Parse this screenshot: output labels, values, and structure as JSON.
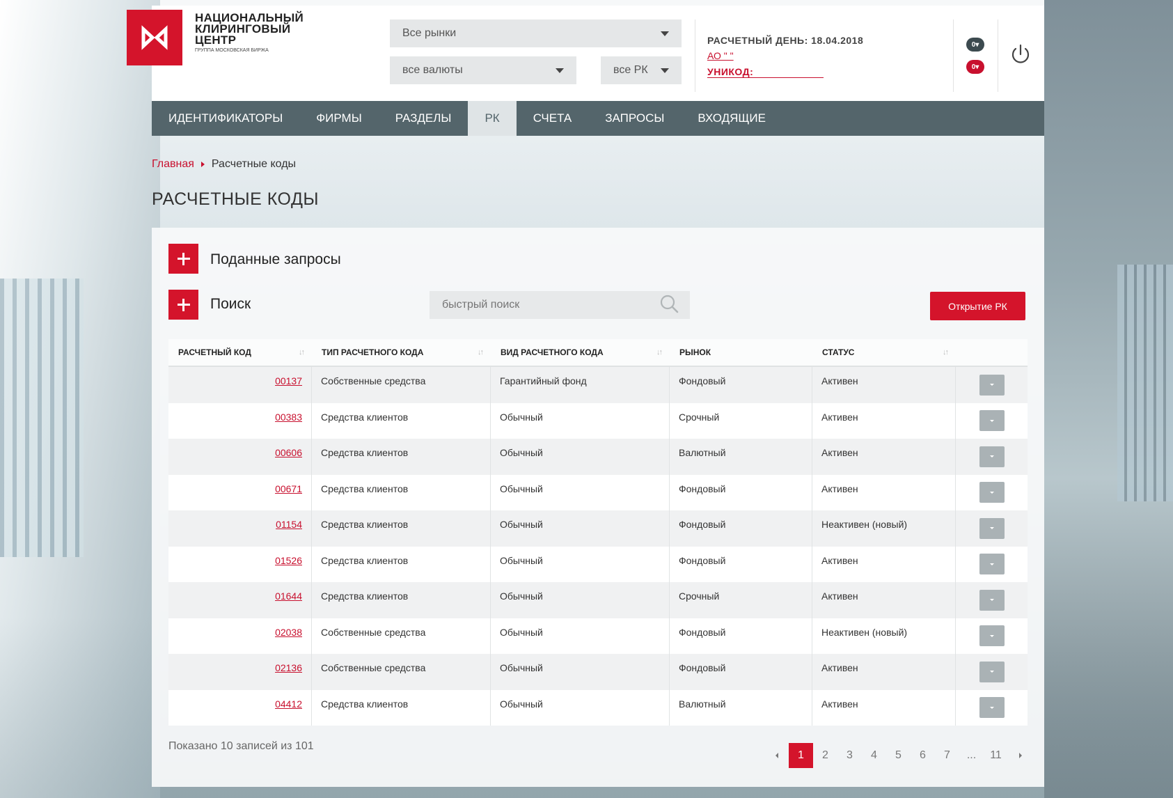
{
  "brand": {
    "line1": "НАЦИОНАЛЬНЫЙ",
    "line2": "КЛИРИНГОВЫЙ",
    "line3": "ЦЕНТР",
    "sub": "ГРУППА МОСКОВСКАЯ БИРЖА",
    "color": "#d4142b"
  },
  "filters": {
    "market": "Все рынки",
    "currency": "все валюты",
    "rk": "все РК"
  },
  "session": {
    "day_label": "РАСЧЕТНЫЙ ДЕНЬ: 18.04.2018",
    "org": "АО \"            \"",
    "unikod": "УНИКОД:"
  },
  "badges": {
    "top": "0▾",
    "bottom": "0▾"
  },
  "nav": {
    "items": [
      "ИДЕНТИФИКАТОРЫ",
      "ФИРМЫ",
      "РАЗДЕЛЫ",
      "РК",
      "СЧЕТА",
      "ЗАПРОСЫ",
      "ВХОДЯЩИЕ"
    ],
    "active": "РК"
  },
  "breadcrumb": {
    "home": "Главная",
    "current": "Расчетные коды"
  },
  "page_title": "РАСЧЕТНЫЕ КОДЫ",
  "sections": {
    "requests": "Поданные запросы",
    "search": "Поиск"
  },
  "search": {
    "placeholder": "быстрый поиск"
  },
  "open_button": "Открытие РК",
  "table": {
    "headers": [
      "РАСЧЕТНЫЙ КОД",
      "ТИП РАСЧЕТНОГО КОДА",
      "ВИД РАСЧЕТНОГО КОДА",
      "РЫНОК",
      "СТАТУС"
    ],
    "rows": [
      [
        "00137",
        "Собственные средства",
        "Гарантийный фонд",
        "Фондовый",
        "Активен"
      ],
      [
        "00383",
        "Средства клиентов",
        "Обычный",
        "Срочный",
        "Активен"
      ],
      [
        "00606",
        "Средства клиентов",
        "Обычный",
        "Валютный",
        "Активен"
      ],
      [
        "00671",
        "Средства клиентов",
        "Обычный",
        "Фондовый",
        "Активен"
      ],
      [
        "01154",
        "Средства клиентов",
        "Обычный",
        "Фондовый",
        "Неактивен (новый)"
      ],
      [
        "01526",
        "Средства клиентов",
        "Обычный",
        "Фондовый",
        "Активен"
      ],
      [
        "01644",
        "Средства клиентов",
        "Обычный",
        "Срочный",
        "Активен"
      ],
      [
        "02038",
        "Собственные средства",
        "Обычный",
        "Фондовый",
        "Неактивен (новый)"
      ],
      [
        "02136",
        "Собственные средства",
        "Обычный",
        "Фондовый",
        "Активен"
      ],
      [
        "04412",
        "Средства клиентов",
        "Обычный",
        "Валютный",
        "Активен"
      ]
    ]
  },
  "footer": {
    "showing": "Показано 10 записей из 101"
  },
  "pagination": {
    "pages": [
      "1",
      "2",
      "3",
      "4",
      "5",
      "6",
      "7",
      "...",
      "11"
    ],
    "current": "1"
  }
}
